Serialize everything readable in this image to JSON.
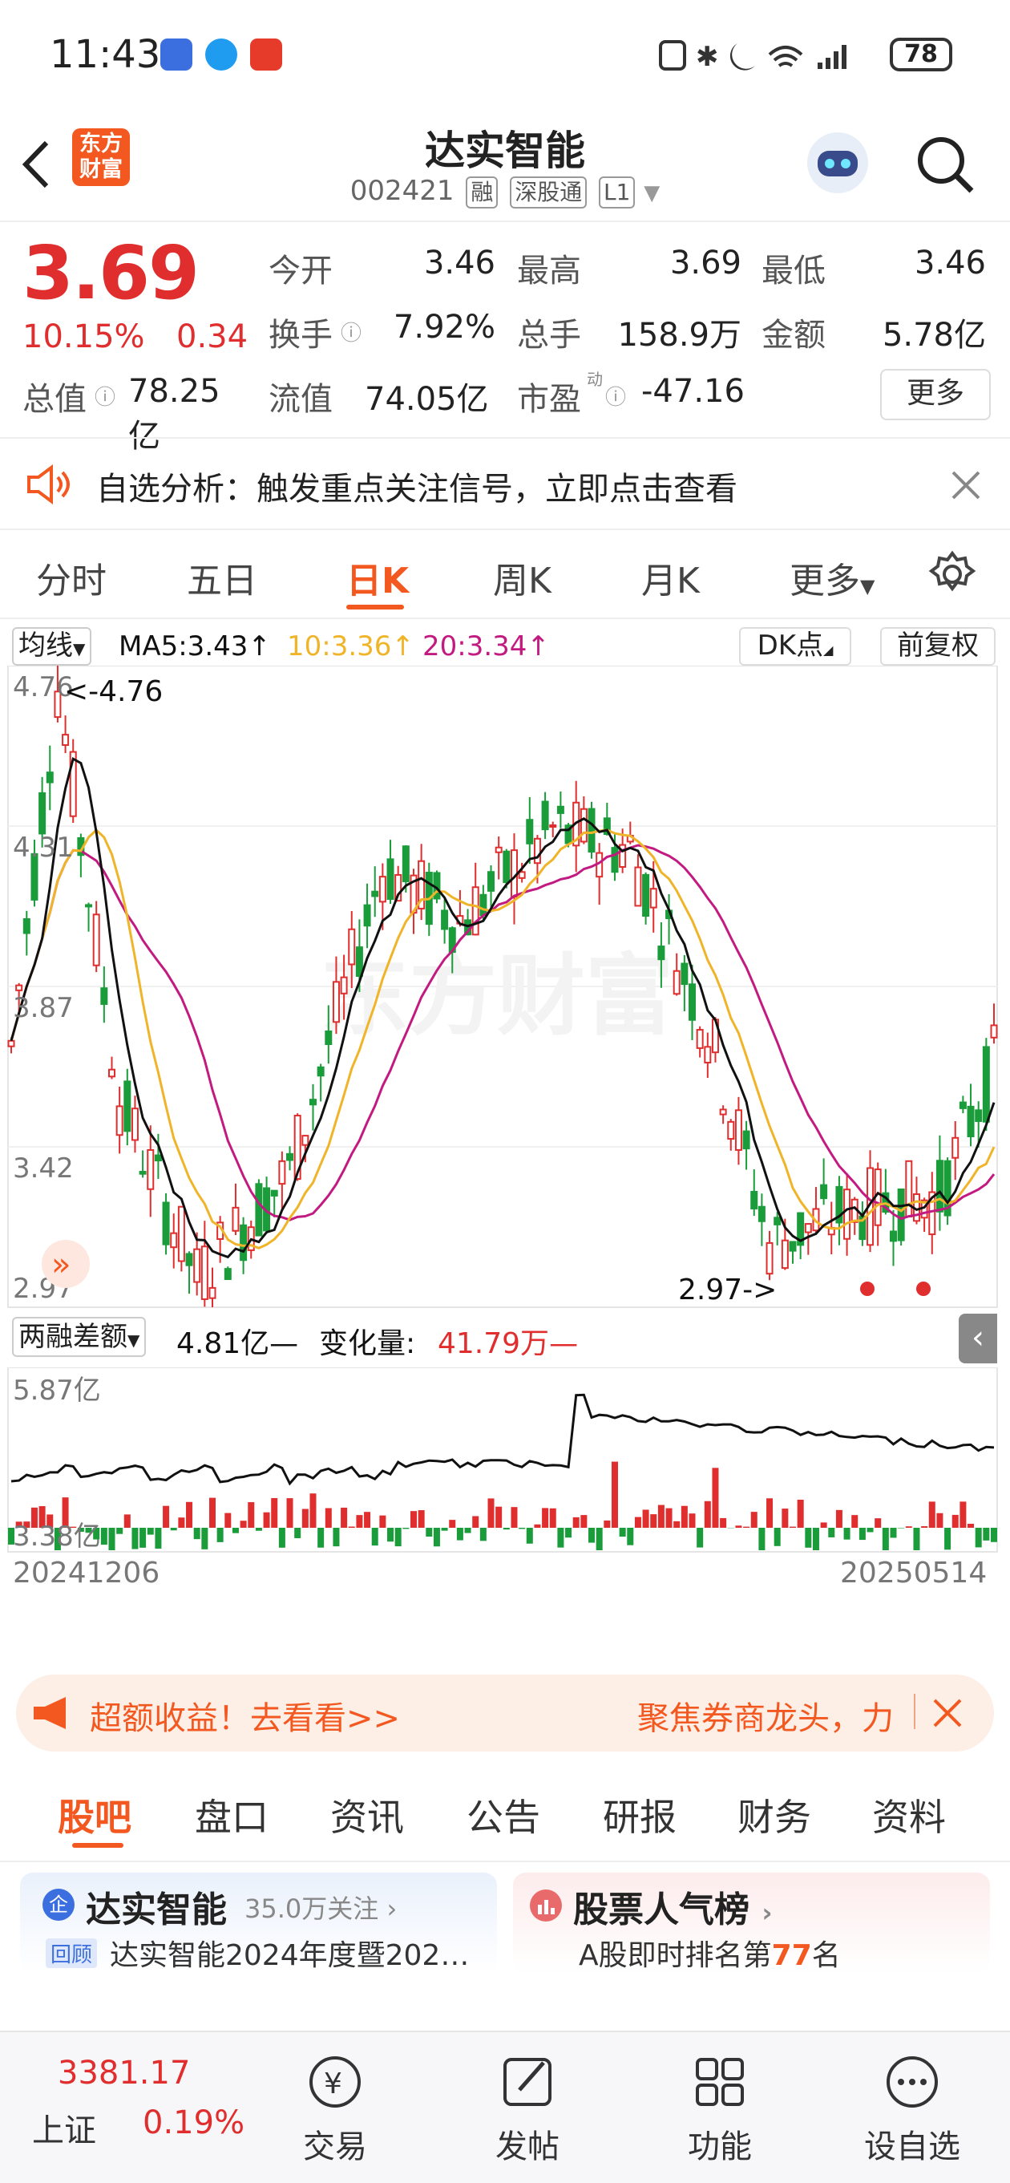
{
  "status_bar": {
    "time": "11:43",
    "battery": "78"
  },
  "header": {
    "logo_text_1": "东方",
    "logo_text_2": "财富",
    "title": "达实智能",
    "code": "002421",
    "tags": [
      "融",
      "深股通",
      "L1"
    ]
  },
  "quote": {
    "price": "3.69",
    "change_pct": "10.15%",
    "change": "0.34",
    "rows": [
      [
        {
          "label": "今开",
          "value": "3.46",
          "color": "#e02d2d"
        },
        {
          "label": "最高",
          "value": "3.69",
          "color": "#e02d2d"
        },
        {
          "label": "最低",
          "value": "3.46",
          "color": "#e02d2d"
        }
      ],
      [
        {
          "label": "换手",
          "value": "7.92%",
          "color": "#222"
        },
        {
          "label": "总手",
          "value": "158.9万",
          "color": "#222"
        },
        {
          "label": "金额",
          "value": "5.78亿",
          "color": "#222"
        }
      ]
    ],
    "total_value_label": "总值",
    "total_value": "78.25亿",
    "float_value_label": "流值",
    "float_value": "74.05亿",
    "pe_label": "市盈",
    "pe_sup": "动",
    "pe_value": "-47.16",
    "more_button": "更多"
  },
  "alert": {
    "text": "自选分析：触发重点关注信号，立即点击查看"
  },
  "tabs": [
    "分时",
    "五日",
    "日K",
    "周K",
    "月K",
    "更多"
  ],
  "active_tab": 2,
  "kline": {
    "indicator_select": "均线",
    "ma5": "MA5:3.43",
    "ma10": "10:3.36",
    "ma20": "20:3.34",
    "dk_button": "DK点",
    "adjust_button": "前复权",
    "y_labels": [
      "4.76",
      "4.31",
      "3.87",
      "3.42",
      "2.97"
    ],
    "high_marker": "<-4.76",
    "low_marker": "2.97->",
    "watermark": "东方财富"
  },
  "margin": {
    "select": "两融差额",
    "value": "4.81亿",
    "change_label": "变化量:",
    "change_value": "41.79万",
    "y_top": "5.87亿",
    "y_bottom": "3.38亿",
    "date_start": "20241206",
    "date_end": "20250514"
  },
  "promo": {
    "left_text": "超额收益！去看看>>",
    "right_text": "聚焦券商龙头，力"
  },
  "content_tabs": [
    "股吧",
    "盘口",
    "资讯",
    "公告",
    "研报",
    "财务",
    "资料"
  ],
  "active_content_tab": 0,
  "cards": {
    "left_badge": "企",
    "left_title": "达实智能",
    "left_followers": "35.0万关注",
    "left_tag": "回顾",
    "left_desc": "达实智能2024年度暨202…",
    "right_title": "股票人气榜",
    "right_desc_prefix": "A股即时排名第",
    "right_rank": "77",
    "right_desc_suffix": "名"
  },
  "bottom_nav": {
    "index_value": "3381.17",
    "index_name": "上证",
    "index_change": "0.19%",
    "items": [
      "交易",
      "发帖",
      "功能",
      "设自选"
    ]
  },
  "colors": {
    "up": "#e02d2d",
    "down": "#1a9c3a",
    "accent": "#f2581f",
    "ma5": "#111111",
    "ma10": "#f0b429",
    "ma20": "#c21a80"
  }
}
